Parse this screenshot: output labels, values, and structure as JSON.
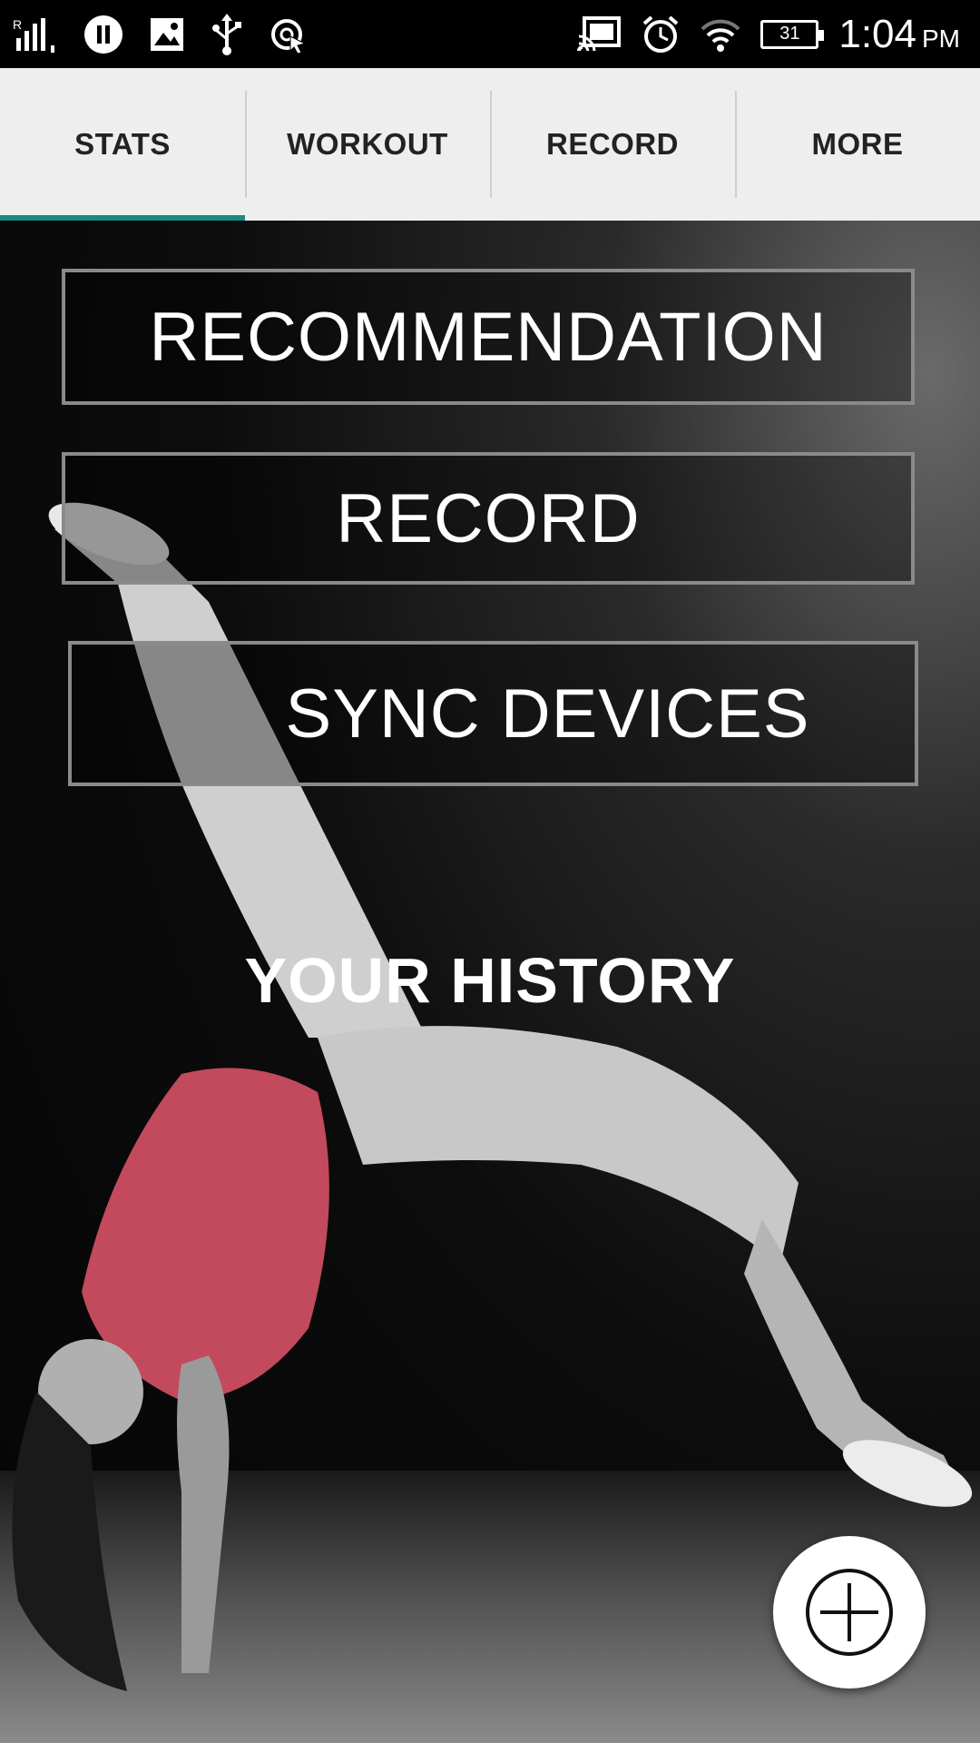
{
  "status_bar": {
    "time": "1:04",
    "ampm": "PM",
    "battery": "31",
    "left_icons": [
      "signal-icon",
      "pause-icon",
      "image-icon",
      "usb-icon",
      "sync-icon"
    ],
    "right_icons": [
      "cast-icon",
      "alarm-icon",
      "wifi-icon",
      "battery-icon"
    ]
  },
  "tabs": [
    {
      "label": "STATS",
      "active": true
    },
    {
      "label": "WORKOUT",
      "active": false
    },
    {
      "label": "RECORD",
      "active": false
    },
    {
      "label": "MORE",
      "active": false
    }
  ],
  "menu": {
    "recommendation": "RECOMMENDATION",
    "record": "RECORD",
    "sync_devices": "SYNC DEVICES"
  },
  "history_title": "YOUR HISTORY",
  "colors": {
    "tab_indicator": "#1a8a80",
    "tab_bg": "#eeeeee",
    "shirt": "#c24a5c"
  }
}
